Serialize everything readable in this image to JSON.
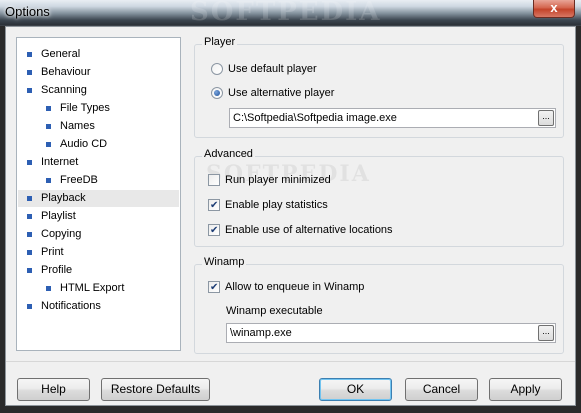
{
  "window": {
    "title": "Options",
    "close_glyph": "x",
    "watermark": "SOFTPEDIA"
  },
  "nav": {
    "items": [
      {
        "label": "General",
        "level": 0
      },
      {
        "label": "Behaviour",
        "level": 0
      },
      {
        "label": "Scanning",
        "level": 0
      },
      {
        "label": "File Types",
        "level": 1
      },
      {
        "label": "Names",
        "level": 1
      },
      {
        "label": "Audio CD",
        "level": 1
      },
      {
        "label": "Internet",
        "level": 0
      },
      {
        "label": "FreeDB",
        "level": 1
      },
      {
        "label": "Playback",
        "level": 0,
        "selected": true
      },
      {
        "label": "Playlist",
        "level": 0
      },
      {
        "label": "Copying",
        "level": 0
      },
      {
        "label": "Print",
        "level": 0
      },
      {
        "label": "Profile",
        "level": 0
      },
      {
        "label": "HTML Export",
        "level": 1
      },
      {
        "label": "Notifications",
        "level": 0
      }
    ],
    "bullet_color": "#2d5fb3"
  },
  "player": {
    "group_title": "Player",
    "use_default_label": "Use default player",
    "use_alternative_label": "Use alternative player",
    "selected": "alternative",
    "path_value": "C:\\Softpedia\\Softpedia image.exe",
    "browse_glyph": "..."
  },
  "advanced": {
    "group_title": "Advanced",
    "run_minimized_label": "Run player minimized",
    "run_minimized_checked": false,
    "play_stats_label": "Enable play statistics",
    "play_stats_checked": true,
    "alt_locations_label": "Enable use of alternative locations",
    "alt_locations_checked": true
  },
  "winamp": {
    "group_title": "Winamp",
    "enqueue_label": "Allow to enqueue in Winamp",
    "enqueue_checked": true,
    "exe_label": "Winamp executable",
    "exe_value": "\\winamp.exe",
    "browse_glyph": "..."
  },
  "buttons": {
    "help": "Help",
    "restore_defaults": "Restore Defaults",
    "ok": "OK",
    "cancel": "Cancel",
    "apply": "Apply"
  }
}
